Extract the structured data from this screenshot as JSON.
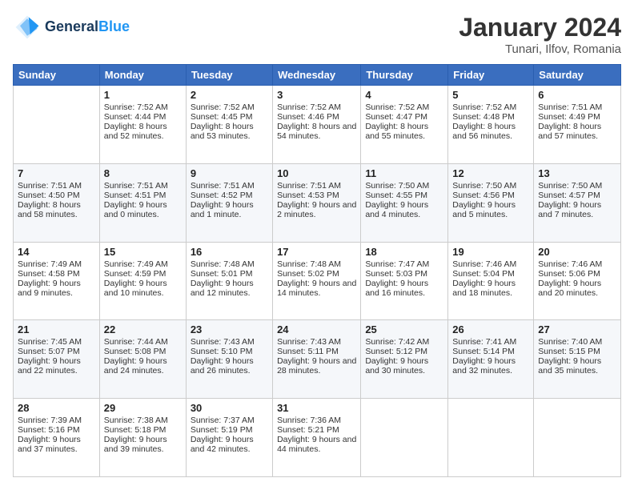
{
  "header": {
    "logo_line1": "General",
    "logo_line2": "Blue",
    "month": "January 2024",
    "location": "Tunari, Ilfov, Romania"
  },
  "days_of_week": [
    "Sunday",
    "Monday",
    "Tuesday",
    "Wednesday",
    "Thursday",
    "Friday",
    "Saturday"
  ],
  "weeks": [
    [
      {
        "day": "",
        "sunrise": "",
        "sunset": "",
        "daylight": ""
      },
      {
        "day": "1",
        "sunrise": "Sunrise: 7:52 AM",
        "sunset": "Sunset: 4:44 PM",
        "daylight": "Daylight: 8 hours and 52 minutes."
      },
      {
        "day": "2",
        "sunrise": "Sunrise: 7:52 AM",
        "sunset": "Sunset: 4:45 PM",
        "daylight": "Daylight: 8 hours and 53 minutes."
      },
      {
        "day": "3",
        "sunrise": "Sunrise: 7:52 AM",
        "sunset": "Sunset: 4:46 PM",
        "daylight": "Daylight: 8 hours and 54 minutes."
      },
      {
        "day": "4",
        "sunrise": "Sunrise: 7:52 AM",
        "sunset": "Sunset: 4:47 PM",
        "daylight": "Daylight: 8 hours and 55 minutes."
      },
      {
        "day": "5",
        "sunrise": "Sunrise: 7:52 AM",
        "sunset": "Sunset: 4:48 PM",
        "daylight": "Daylight: 8 hours and 56 minutes."
      },
      {
        "day": "6",
        "sunrise": "Sunrise: 7:51 AM",
        "sunset": "Sunset: 4:49 PM",
        "daylight": "Daylight: 8 hours and 57 minutes."
      }
    ],
    [
      {
        "day": "7",
        "sunrise": "Sunrise: 7:51 AM",
        "sunset": "Sunset: 4:50 PM",
        "daylight": "Daylight: 8 hours and 58 minutes."
      },
      {
        "day": "8",
        "sunrise": "Sunrise: 7:51 AM",
        "sunset": "Sunset: 4:51 PM",
        "daylight": "Daylight: 9 hours and 0 minutes."
      },
      {
        "day": "9",
        "sunrise": "Sunrise: 7:51 AM",
        "sunset": "Sunset: 4:52 PM",
        "daylight": "Daylight: 9 hours and 1 minute."
      },
      {
        "day": "10",
        "sunrise": "Sunrise: 7:51 AM",
        "sunset": "Sunset: 4:53 PM",
        "daylight": "Daylight: 9 hours and 2 minutes."
      },
      {
        "day": "11",
        "sunrise": "Sunrise: 7:50 AM",
        "sunset": "Sunset: 4:55 PM",
        "daylight": "Daylight: 9 hours and 4 minutes."
      },
      {
        "day": "12",
        "sunrise": "Sunrise: 7:50 AM",
        "sunset": "Sunset: 4:56 PM",
        "daylight": "Daylight: 9 hours and 5 minutes."
      },
      {
        "day": "13",
        "sunrise": "Sunrise: 7:50 AM",
        "sunset": "Sunset: 4:57 PM",
        "daylight": "Daylight: 9 hours and 7 minutes."
      }
    ],
    [
      {
        "day": "14",
        "sunrise": "Sunrise: 7:49 AM",
        "sunset": "Sunset: 4:58 PM",
        "daylight": "Daylight: 9 hours and 9 minutes."
      },
      {
        "day": "15",
        "sunrise": "Sunrise: 7:49 AM",
        "sunset": "Sunset: 4:59 PM",
        "daylight": "Daylight: 9 hours and 10 minutes."
      },
      {
        "day": "16",
        "sunrise": "Sunrise: 7:48 AM",
        "sunset": "Sunset: 5:01 PM",
        "daylight": "Daylight: 9 hours and 12 minutes."
      },
      {
        "day": "17",
        "sunrise": "Sunrise: 7:48 AM",
        "sunset": "Sunset: 5:02 PM",
        "daylight": "Daylight: 9 hours and 14 minutes."
      },
      {
        "day": "18",
        "sunrise": "Sunrise: 7:47 AM",
        "sunset": "Sunset: 5:03 PM",
        "daylight": "Daylight: 9 hours and 16 minutes."
      },
      {
        "day": "19",
        "sunrise": "Sunrise: 7:46 AM",
        "sunset": "Sunset: 5:04 PM",
        "daylight": "Daylight: 9 hours and 18 minutes."
      },
      {
        "day": "20",
        "sunrise": "Sunrise: 7:46 AM",
        "sunset": "Sunset: 5:06 PM",
        "daylight": "Daylight: 9 hours and 20 minutes."
      }
    ],
    [
      {
        "day": "21",
        "sunrise": "Sunrise: 7:45 AM",
        "sunset": "Sunset: 5:07 PM",
        "daylight": "Daylight: 9 hours and 22 minutes."
      },
      {
        "day": "22",
        "sunrise": "Sunrise: 7:44 AM",
        "sunset": "Sunset: 5:08 PM",
        "daylight": "Daylight: 9 hours and 24 minutes."
      },
      {
        "day": "23",
        "sunrise": "Sunrise: 7:43 AM",
        "sunset": "Sunset: 5:10 PM",
        "daylight": "Daylight: 9 hours and 26 minutes."
      },
      {
        "day": "24",
        "sunrise": "Sunrise: 7:43 AM",
        "sunset": "Sunset: 5:11 PM",
        "daylight": "Daylight: 9 hours and 28 minutes."
      },
      {
        "day": "25",
        "sunrise": "Sunrise: 7:42 AM",
        "sunset": "Sunset: 5:12 PM",
        "daylight": "Daylight: 9 hours and 30 minutes."
      },
      {
        "day": "26",
        "sunrise": "Sunrise: 7:41 AM",
        "sunset": "Sunset: 5:14 PM",
        "daylight": "Daylight: 9 hours and 32 minutes."
      },
      {
        "day": "27",
        "sunrise": "Sunrise: 7:40 AM",
        "sunset": "Sunset: 5:15 PM",
        "daylight": "Daylight: 9 hours and 35 minutes."
      }
    ],
    [
      {
        "day": "28",
        "sunrise": "Sunrise: 7:39 AM",
        "sunset": "Sunset: 5:16 PM",
        "daylight": "Daylight: 9 hours and 37 minutes."
      },
      {
        "day": "29",
        "sunrise": "Sunrise: 7:38 AM",
        "sunset": "Sunset: 5:18 PM",
        "daylight": "Daylight: 9 hours and 39 minutes."
      },
      {
        "day": "30",
        "sunrise": "Sunrise: 7:37 AM",
        "sunset": "Sunset: 5:19 PM",
        "daylight": "Daylight: 9 hours and 42 minutes."
      },
      {
        "day": "31",
        "sunrise": "Sunrise: 7:36 AM",
        "sunset": "Sunset: 5:21 PM",
        "daylight": "Daylight: 9 hours and 44 minutes."
      },
      {
        "day": "",
        "sunrise": "",
        "sunset": "",
        "daylight": ""
      },
      {
        "day": "",
        "sunrise": "",
        "sunset": "",
        "daylight": ""
      },
      {
        "day": "",
        "sunrise": "",
        "sunset": "",
        "daylight": ""
      }
    ]
  ]
}
